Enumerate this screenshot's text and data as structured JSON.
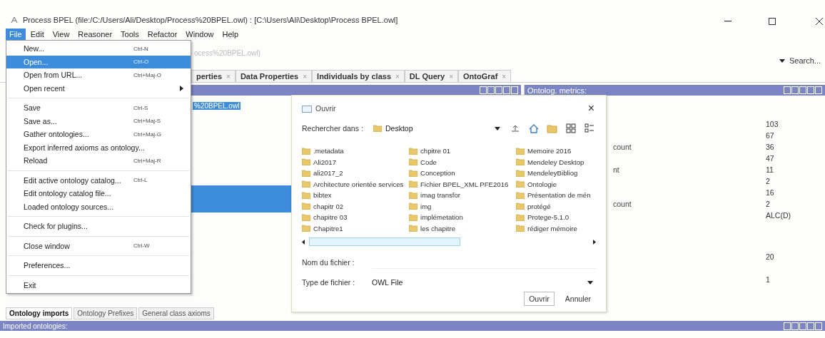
{
  "window": {
    "title": "Process BPEL (file:/C:/Users/Ali/Desktop/Process%20BPEL.owl) : [C:\\Users\\Ali\\Desktop\\Process BPEL.owl]"
  },
  "menubar": [
    {
      "label": "File",
      "selected": true
    },
    {
      "label": "Edit",
      "selected": false
    },
    {
      "label": "View",
      "selected": false
    },
    {
      "label": "Reasoner",
      "selected": false
    },
    {
      "label": "Tools",
      "selected": false
    },
    {
      "label": "Refactor",
      "selected": false
    },
    {
      "label": "Window",
      "selected": false
    },
    {
      "label": "Help",
      "selected": false
    }
  ],
  "address": "ocess%20BPEL.owl)",
  "search": {
    "placeholder": "Search..."
  },
  "tabs": [
    {
      "label": "perties",
      "close": "×"
    },
    {
      "label": "Data Properties",
      "close": "×"
    },
    {
      "label": "Individuals by class",
      "close": "×"
    },
    {
      "label": "DL Query",
      "close": "×"
    },
    {
      "label": "OntoGraf",
      "close": "×"
    }
  ],
  "left_panel": {
    "selected_item": "%20BPEL.owl"
  },
  "metrics_panel": {
    "title": "Ontolog. metrics:",
    "sections": [
      {
        "rows": [
          {
            "value": "103"
          },
          {
            "value": "67"
          },
          {
            "label": "count",
            "value": "36"
          },
          {
            "value": "47"
          },
          {
            "label": "nt",
            "value": "11"
          },
          {
            "value": "2"
          },
          {
            "value": "16"
          },
          {
            "label": "count",
            "value": "2"
          },
          {
            "value": "ALC(D)"
          }
        ]
      },
      {
        "rows": [
          {
            "value": "20"
          }
        ]
      },
      {
        "rows": [
          {
            "value": "1"
          }
        ]
      }
    ]
  },
  "bottom_tabs": [
    {
      "label": "Ontology imports",
      "selected": true
    },
    {
      "label": "Ontology Prefixes",
      "selected": false
    },
    {
      "label": "General class axioms",
      "selected": false
    }
  ],
  "bottom_panel": {
    "title": "Imported ontologies:"
  },
  "file_menu": [
    {
      "label": "New...",
      "shortcut": "Ctrl-N",
      "selected": false
    },
    {
      "label": "Open...",
      "shortcut": "Ctrl-O",
      "selected": true
    },
    {
      "label": "Open from URL...",
      "shortcut": "Ctrl+Maj-O",
      "selected": false
    },
    {
      "label": "Open recent",
      "submenu": true,
      "selected": false
    },
    {
      "label": "Save",
      "shortcut": "Ctrl-S",
      "selected": false,
      "separator_before": true
    },
    {
      "label": "Save as...",
      "shortcut": "Ctrl+Maj-S",
      "selected": false
    },
    {
      "label": "Gather ontologies...",
      "shortcut": "Ctrl+Maj-G",
      "selected": false
    },
    {
      "label": "Export inferred axioms as ontology...",
      "selected": false
    },
    {
      "label": "Reload",
      "shortcut": "Ctrl+Maj-R",
      "selected": false
    },
    {
      "label": "Edit active ontology catalog...",
      "shortcut": "Ctrl-L",
      "selected": false,
      "separator_before": true
    },
    {
      "label": "Edit ontology catalog file...",
      "selected": false
    },
    {
      "label": "Loaded ontology sources...",
      "selected": false
    },
    {
      "label": "Check for plugins...",
      "selected": false,
      "separator_before": true
    },
    {
      "label": "Close window",
      "shortcut": "Ctrl-W",
      "selected": false,
      "separator_before": true
    },
    {
      "label": "Preferences...",
      "selected": false,
      "separator_before": true
    },
    {
      "label": "Exit",
      "selected": false,
      "separator_before": true
    }
  ],
  "open_dialog": {
    "title": "Ouvrir",
    "close": "×",
    "look_in": {
      "label": "Rechercher dans :",
      "value": "Desktop"
    },
    "files": [
      [
        ".metadata",
        "Ali2017",
        "ali2017_2",
        "Architecture orientée services",
        "bibtex",
        "chapitr 02",
        "chapitre 03",
        "Chapitre1"
      ],
      [
        "chpitre 01",
        "Code",
        "Conception",
        "Fichier BPEL_XML PFE2016",
        "imag transfor",
        "img",
        "implémetation",
        "les chapitre"
      ],
      [
        "Memoire 2016",
        "Mendeley Desktop",
        "MendeleyBibliog",
        "Ontologie",
        "Présentation de mén",
        "protégé",
        "Protege-5.1.0",
        "rédiger mémoire"
      ]
    ],
    "file_name": {
      "label": "Nom du fichier :"
    },
    "file_type": {
      "label": "Type de fichier :",
      "value": "OWL File"
    },
    "buttons": [
      "Ouvrir",
      "Annuler"
    ]
  }
}
